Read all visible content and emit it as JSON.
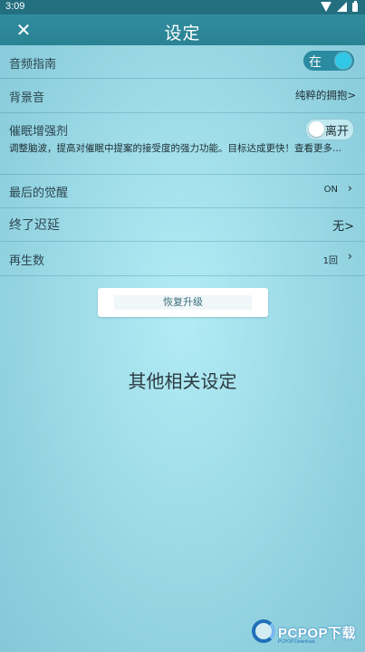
{
  "status_bar": {
    "time": "3:09"
  },
  "header": {
    "title": "设定"
  },
  "settings": {
    "audio_guide": {
      "label": "音频指南",
      "toggle": "在"
    },
    "background_sound": {
      "label": "背景音",
      "value": "纯粹的拥抱>"
    },
    "hypnosis_enhancer": {
      "label": "催眠增强剂",
      "toggle": "离开",
      "description": "调整脑波，提高对催眠中提案的接受度的强力功能。目标达成更快！查看更多..."
    },
    "last_awakening": {
      "label": "最后的觉醒",
      "value": "ON"
    },
    "end_delay": {
      "label": "终了迟延",
      "value": "无>"
    },
    "playback_count": {
      "label": "再生数",
      "value": "1回"
    }
  },
  "restore_button": {
    "label": "恢复升级"
  },
  "other_settings": {
    "label": "其他相关设定"
  },
  "watermark": {
    "brand": "PCPOP下载",
    "sub": "PCPOP.Download"
  }
}
